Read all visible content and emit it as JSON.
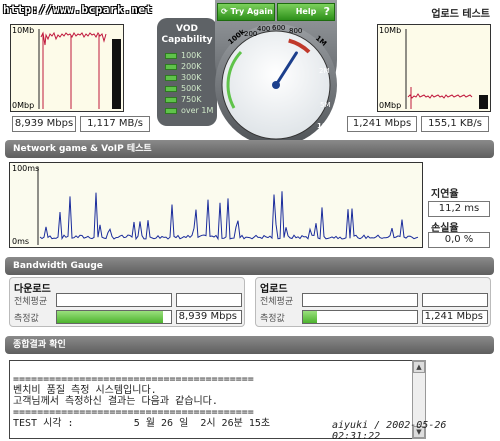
{
  "header": {
    "url_text": "http://www.bcpark.net",
    "upload_title": "업로드 테스트"
  },
  "download_graph": {
    "y_max_label": "10Mb",
    "y_min_label": "0Mbp",
    "speed_mbps": "8,939 Mbps",
    "speed_mbs": "1,117 MB/s",
    "colors": {
      "line": "#c0183c",
      "bar": "#111111"
    }
  },
  "upload_graph": {
    "y_max_label": "10Mb",
    "y_min_label": "0Mbp",
    "speed_mbps": "1,241 Mbps",
    "speed_kbs": "155,1 KB/s"
  },
  "vod": {
    "title_line1": "VOD",
    "title_line2": "Capability",
    "levels": [
      "100K",
      "200K",
      "300K",
      "500K",
      "750K",
      "over 1M"
    ]
  },
  "gauge": {
    "try_again_label": "Try Again",
    "help_label": "Help",
    "help_symbol": "?",
    "scale_labels": [
      "100k",
      "200",
      "400",
      "600",
      "800",
      "1M",
      "2M",
      "5M",
      "10M"
    ],
    "needle_level": 0.62
  },
  "network_section": {
    "title": "Network game & VoIP 테스트",
    "y_max_label": "100ms",
    "y_min_label": "0ms",
    "latency_label": "지연율",
    "latency_value": "11,2 ms",
    "loss_label": "손실율",
    "loss_value": "0,0 %"
  },
  "bandwidth": {
    "title": "Bandwidth Gauge",
    "download": {
      "title": "다운로드",
      "avg_label": "전체평균",
      "measured_label": "측정값",
      "measured_value": "8,939 Mbps",
      "fill_fraction": 0.93
    },
    "upload": {
      "title": "업로드",
      "avg_label": "전체평균",
      "measured_label": "측정값",
      "measured_value": "1,241 Mbps",
      "fill_fraction": 0.12
    }
  },
  "result": {
    "title": "종합결과 확인",
    "lines": [
      "========================================",
      "벤치비 품질 측정 시스템입니다.",
      "고객님께서 측정하신 결과는 다음과 같습니다.",
      "========================================",
      "",
      "TEST 시각 :          5 월 26 일  2시 26분 15초"
    ],
    "footer_note": "aiyuki / 2002-05-26 02:31:22"
  }
}
